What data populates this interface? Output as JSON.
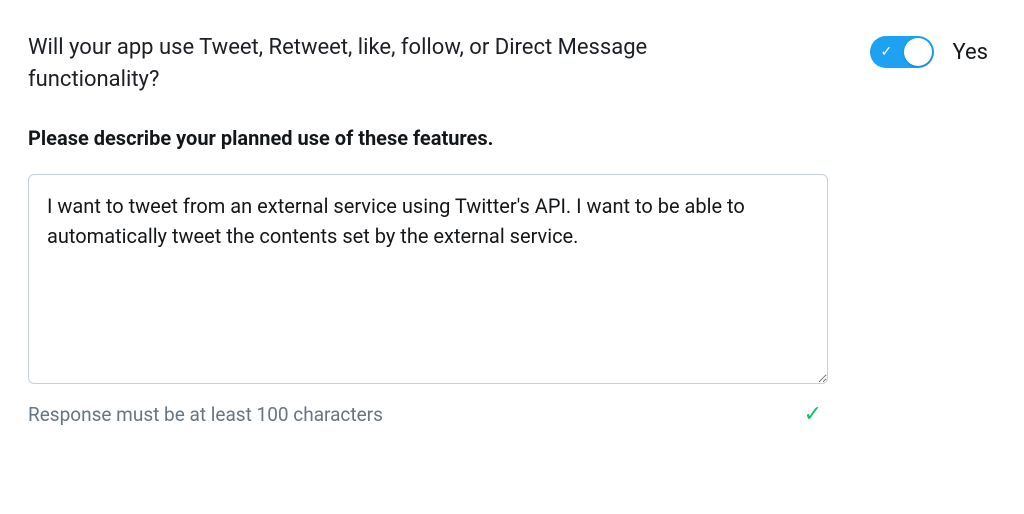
{
  "question": {
    "text": "Will your app use Tweet, Retweet, like, follow, or Direct Message functionality?",
    "toggle_label": "Yes",
    "toggle_on": true
  },
  "section": {
    "subheading": "Please describe your planned use of these features."
  },
  "form": {
    "description_value": "I want to tweet from an external service using Twitter's API. I want to be able to automatically tweet the contents set by the external service.",
    "helper_text": "Response must be at least 100 characters",
    "valid": true
  },
  "icons": {
    "toggle_check": "✓",
    "valid_check": "✓"
  }
}
